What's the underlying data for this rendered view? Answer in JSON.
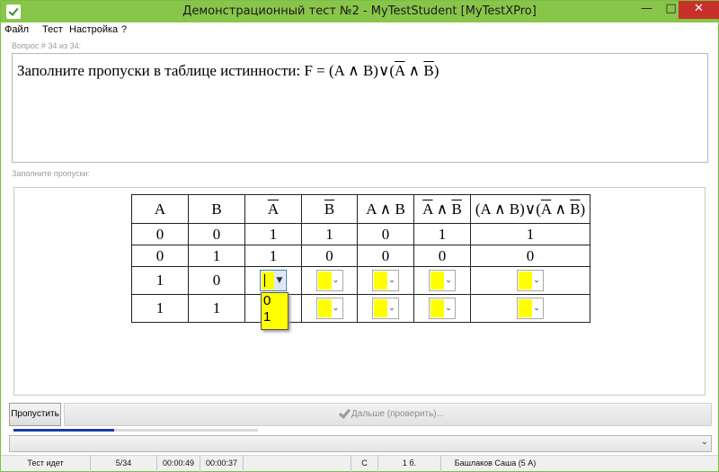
{
  "window": {
    "title": "Демонстрационный тест №2 - MyTestStudent [MyTestXPro]",
    "controls": {
      "minimize": "—",
      "maximize": "□",
      "close": "✕"
    }
  },
  "menu": {
    "items": [
      "Файл",
      "Тест",
      "Настройка",
      "?"
    ]
  },
  "question": {
    "counter": "Вопрос # 34 из 34:",
    "text_prefix": "Заполните пропуски в таблице истинности: F = (A ∧ B)∨(",
    "text_bar1": "A",
    "text_mid": " ∧ ",
    "text_bar2": "B",
    "text_suffix": ")"
  },
  "fill_label": "Заполните пропуски:",
  "table": {
    "headers": {
      "a": "A",
      "b": "B",
      "not_a": "A",
      "not_b": "B",
      "a_and_b": "A ∧ B",
      "not_a_and_not_b": {
        "left": "A",
        "op": " ∧ ",
        "right": "B"
      },
      "f": {
        "prefix": "(A ∧ B)∨(",
        "left": "A",
        "op": " ∧ ",
        "right": "B",
        "suffix": ")"
      }
    },
    "rows": [
      [
        "0",
        "0",
        "1",
        "1",
        "0",
        "1",
        "1"
      ],
      [
        "0",
        "1",
        "1",
        "0",
        "0",
        "0",
        "0"
      ],
      [
        "1",
        "0"
      ],
      [
        "1",
        "1"
      ]
    ]
  },
  "dropdown_popup": {
    "options": [
      "0",
      "1"
    ]
  },
  "buttons": {
    "skip": "Пропустить",
    "next": "Дальше (проверить)..."
  },
  "progress": {
    "fraction": 0.41
  },
  "combo_arrow": "⌄",
  "status": {
    "state": "Тест идет",
    "count": "5/34",
    "elapsed": "00:00:49",
    "remaining": "00:00:37",
    "mode": "C",
    "score": "1 б.",
    "user": "Башлаков Саша (5 А)"
  },
  "colors": {
    "titlebar": "#8ac54b",
    "close": "#c7312a",
    "fill_cell": "#ffff00",
    "progress": "#1c3fa6"
  }
}
